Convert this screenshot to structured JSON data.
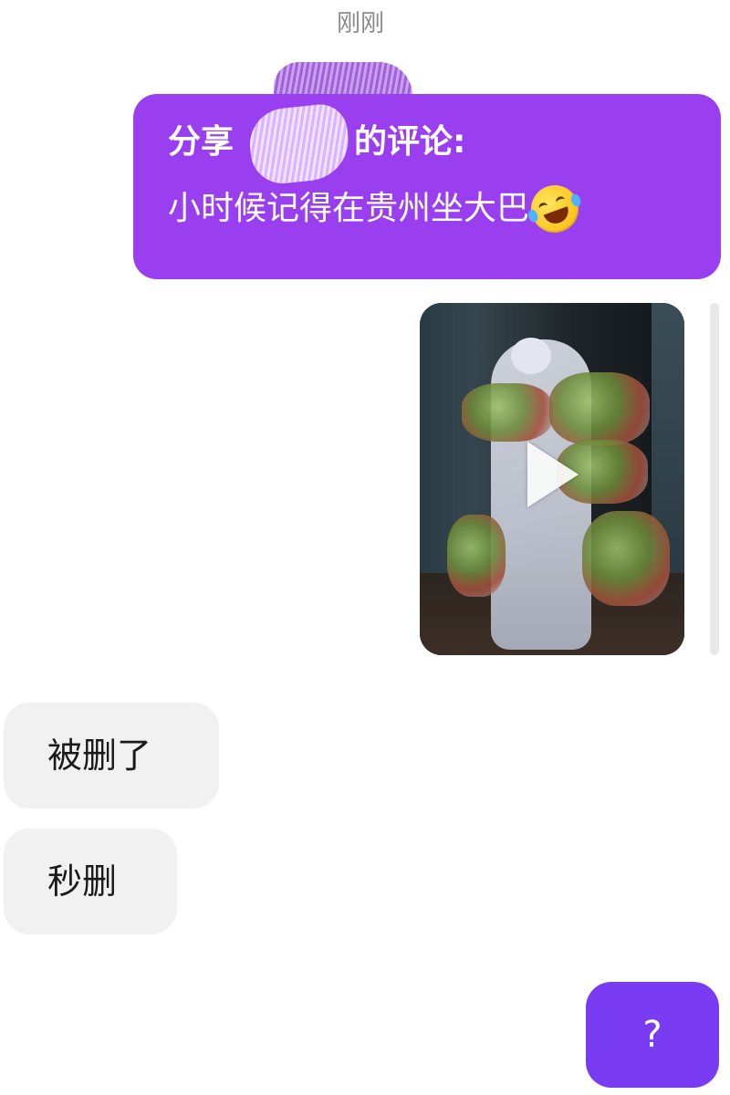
{
  "timestamp": "刚刚",
  "share": {
    "title_prefix": "分享",
    "title_suffix": "的评论:",
    "comment": "小时候记得在贵州坐大巴",
    "emoji": "rolling-on-floor-laughing-emoji"
  },
  "video": {
    "play_icon": "play-icon"
  },
  "messages": {
    "incoming_1": "被删了",
    "incoming_2": "秒删",
    "outgoing_1": "?"
  },
  "colors": {
    "share_bubble": "#9a3ff0",
    "outgoing_bubble": "#7a3cf2",
    "incoming_bubble": "#f1f1f1"
  }
}
